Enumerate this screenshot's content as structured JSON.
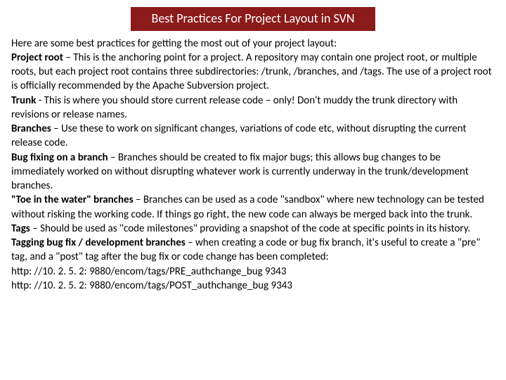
{
  "title": "Best Practices For Project Layout in SVN",
  "intro": "Here are some best practices for getting the most out of your project layout:",
  "items": [
    {
      "label": "Project root",
      "sep": " – ",
      "text": "This is the anchoring point for a project. A repository may contain one project root, or multiple roots, but each project root contains three subdirectories: /trunk, /branches, and /tags. The use of a project root is officially recommended by the Apache Subversion project."
    },
    {
      "label": "Trunk",
      "sep": " - ",
      "text": "This is where you should store current release code – only! Don't muddy the trunk directory with revisions or release names."
    },
    {
      "label": "Branches",
      "sep": " – ",
      "text": "Use these to work on significant changes, variations of code etc, without disrupting the current release code."
    },
    {
      "label": "Bug fixing on a branch",
      "sep": " – ",
      "text": "Branches should be created to fix major bugs; this allows bug changes to be immediately worked on without disrupting whatever work is currently underway in the trunk/development branches."
    },
    {
      "label": "\"Toe in the water\" branches",
      "sep": " – ",
      "text": "Branches can be used as a code \"sandbox\" where new technology can be tested without risking the working code. If things go right, the new code can always be merged back into the trunk."
    },
    {
      "label": "Tags",
      "sep": " – ",
      "text": "Should be used as \"code milestones\" providing a snapshot of the code at specific points in its history."
    },
    {
      "label": "Tagging bug fix / development branches",
      "sep": " – ",
      "text": "when creating a code or bug fix branch, it's useful to create a \"pre\" tag, and a \"post\" tag after the bug fix or code change has been completed:"
    }
  ],
  "urls": [
    "http: //10. 2. 5. 2: 9880/encom/tags/PRE_authchange_bug 9343",
    "http: //10. 2. 5. 2: 9880/encom/tags/POST_authchange_bug 9343"
  ]
}
